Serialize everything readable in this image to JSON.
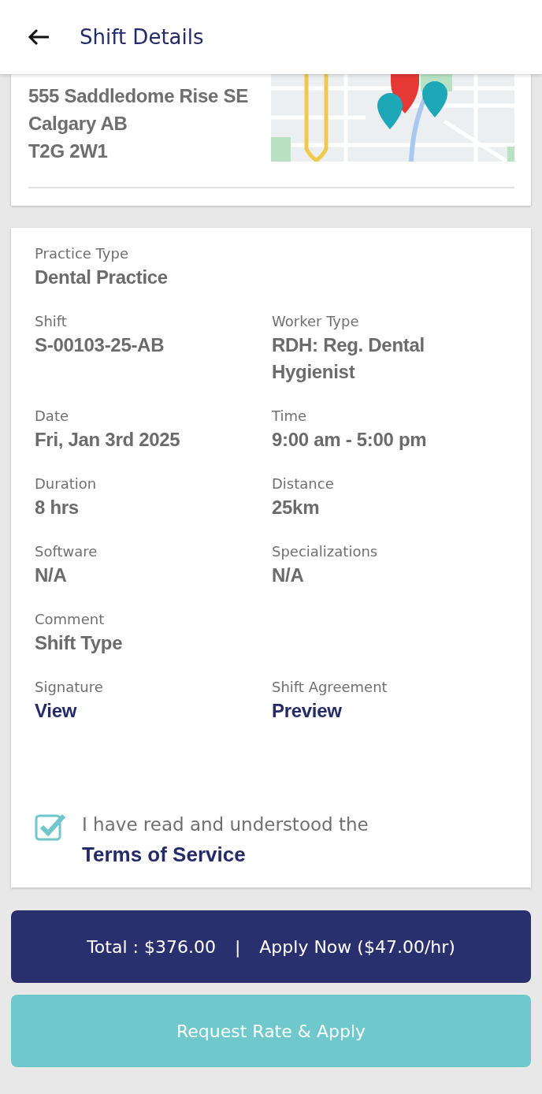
{
  "header": {
    "title": "Shift Details"
  },
  "address": {
    "lines": [
      "555 Saddledome Rise SE",
      "Calgary AB",
      "T2G 2W1"
    ]
  },
  "details": [
    [
      {
        "label": "Practice Type",
        "value": "Dental Practice",
        "kind": "text"
      }
    ],
    [
      {
        "label": "Shift",
        "value": "S-00103-25-AB",
        "kind": "text"
      },
      {
        "label": "Worker Type",
        "value": "RDH: Reg. Dental Hygienist",
        "kind": "text"
      }
    ],
    [
      {
        "label": "Date",
        "value": "Fri, Jan 3rd 2025",
        "kind": "text"
      },
      {
        "label": "Time",
        "value": "9:00 am - 5:00 pm",
        "kind": "text"
      }
    ],
    [
      {
        "label": "Duration",
        "value": "8 hrs",
        "kind": "text"
      },
      {
        "label": "Distance",
        "value": "25km",
        "kind": "text"
      }
    ],
    [
      {
        "label": "Software",
        "value": "N/A",
        "kind": "text"
      },
      {
        "label": "Specializations",
        "value": "N/A",
        "kind": "text"
      }
    ],
    [
      {
        "label": "Comment",
        "value": "Shift Type",
        "kind": "text"
      }
    ],
    [
      {
        "label": "Signature",
        "value": "View",
        "kind": "link"
      },
      {
        "label": "Shift Agreement",
        "value": "Preview",
        "kind": "link"
      }
    ]
  ],
  "terms": {
    "text": "I have read and understood the",
    "link": "Terms of Service",
    "checked": true
  },
  "buttons": [
    {
      "kind": "primary",
      "total": "Total : $376.00",
      "separator": "|",
      "label": "Apply Now ($47.00/hr)"
    },
    {
      "kind": "secondary",
      "label": "Request Rate & Apply"
    }
  ]
}
